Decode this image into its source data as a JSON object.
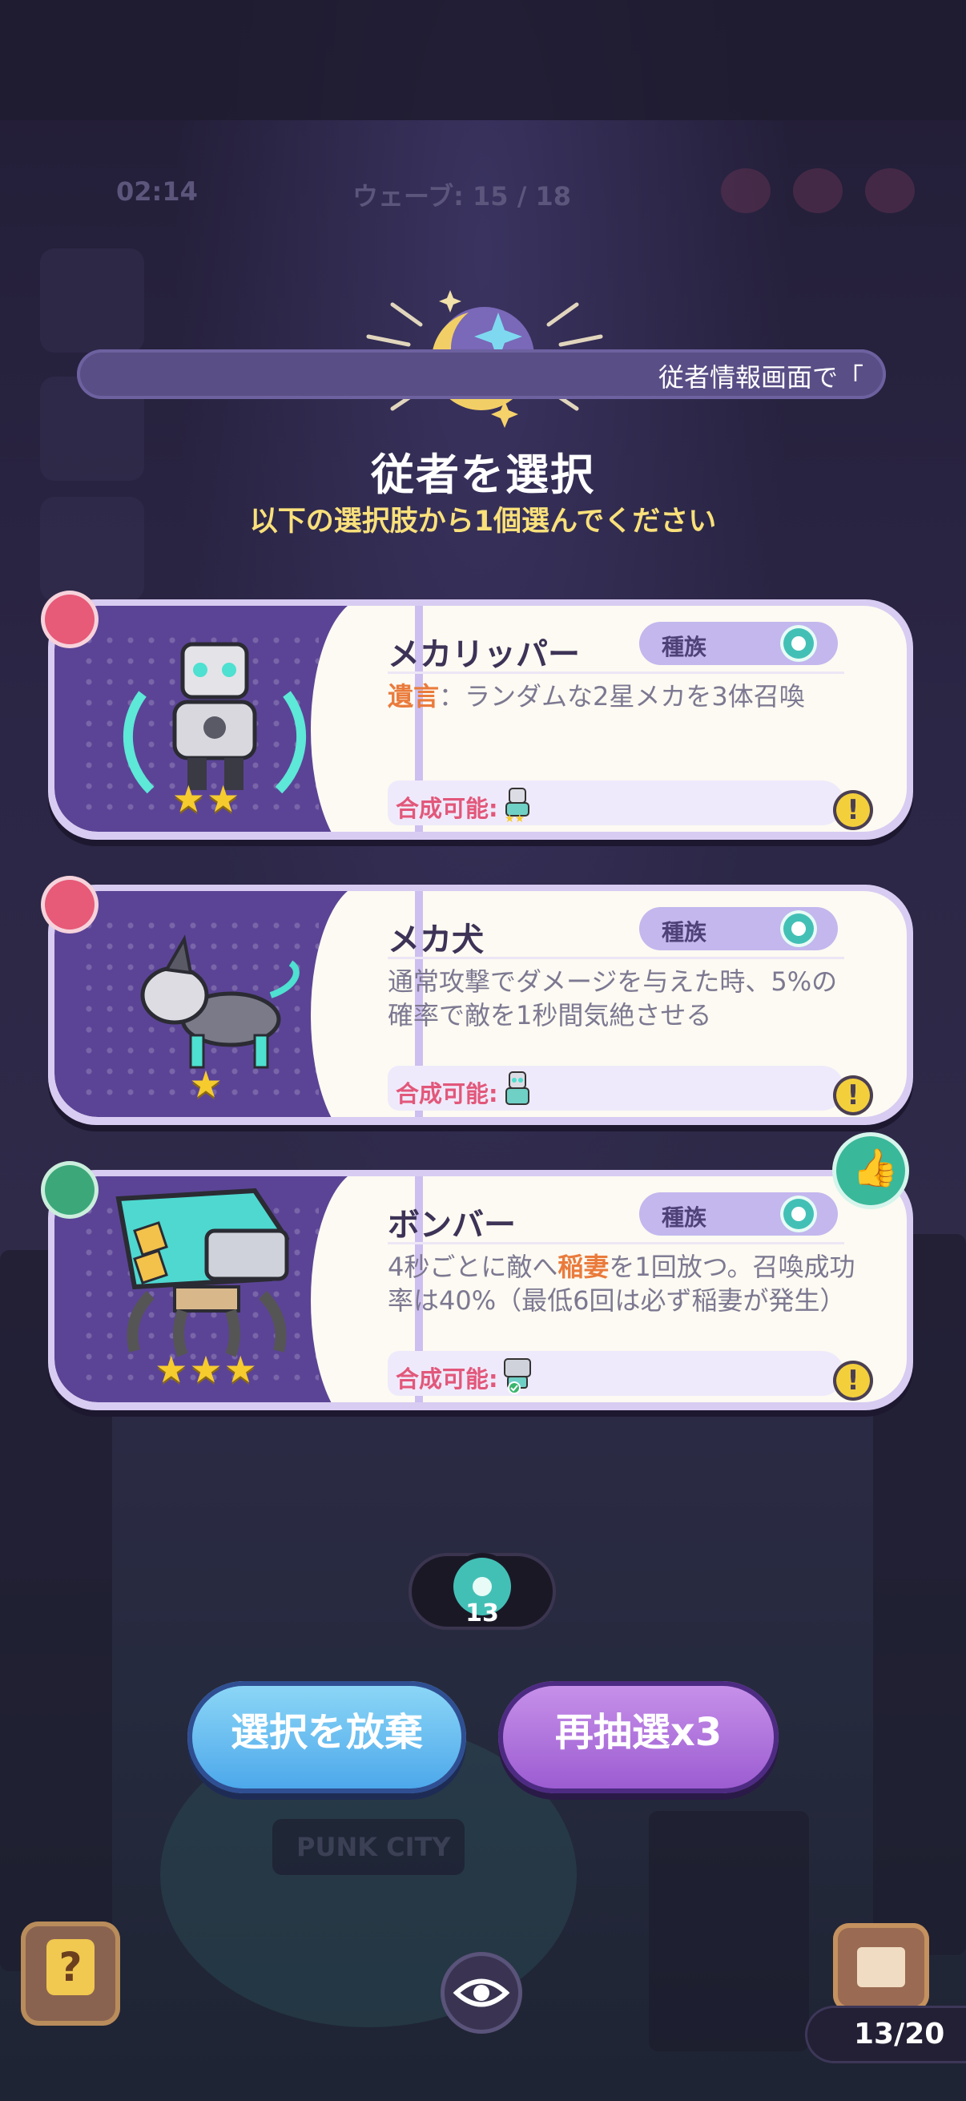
{
  "hud": {
    "timer": "02:14",
    "wave": "ウェーブ: 15 / 18"
  },
  "banner": {
    "text": "従者情報画面で「"
  },
  "header": {
    "title": "従者を選択",
    "subtitle": "以下の選択肢から1個選んでください"
  },
  "cards": [
    {
      "name": "メカリッパー",
      "tag": "種族",
      "desc_keyword": "遺言",
      "desc_text": "：ランダムな2星メカを3体召喚",
      "merge_label": "合成可能:",
      "stars": "★★",
      "info": "!"
    },
    {
      "name": "メカ犬",
      "tag": "種族",
      "desc_text": "通常攻撃でダメージを与えた時、5%の確率で敵を1秒間気絶させる",
      "merge_label": "合成可能:",
      "stars": "★",
      "info": "!"
    },
    {
      "name": "ボンバー",
      "tag": "種族",
      "desc_pre": "4秒ごとに敵へ",
      "desc_keyword": "稲妻",
      "desc_post": "を1回放つ。召喚成功率は40%（最低6回は必ず稲妻が発生）",
      "merge_label": "合成可能:",
      "stars": "★★★",
      "info": "!"
    }
  ],
  "counter": {
    "value": "13"
  },
  "buttons": {
    "abandon": "選択を放棄",
    "reroll": "再抽選x3"
  },
  "bottom": {
    "help": "?",
    "progress": "13/20",
    "sign": "PUNK CITY"
  }
}
